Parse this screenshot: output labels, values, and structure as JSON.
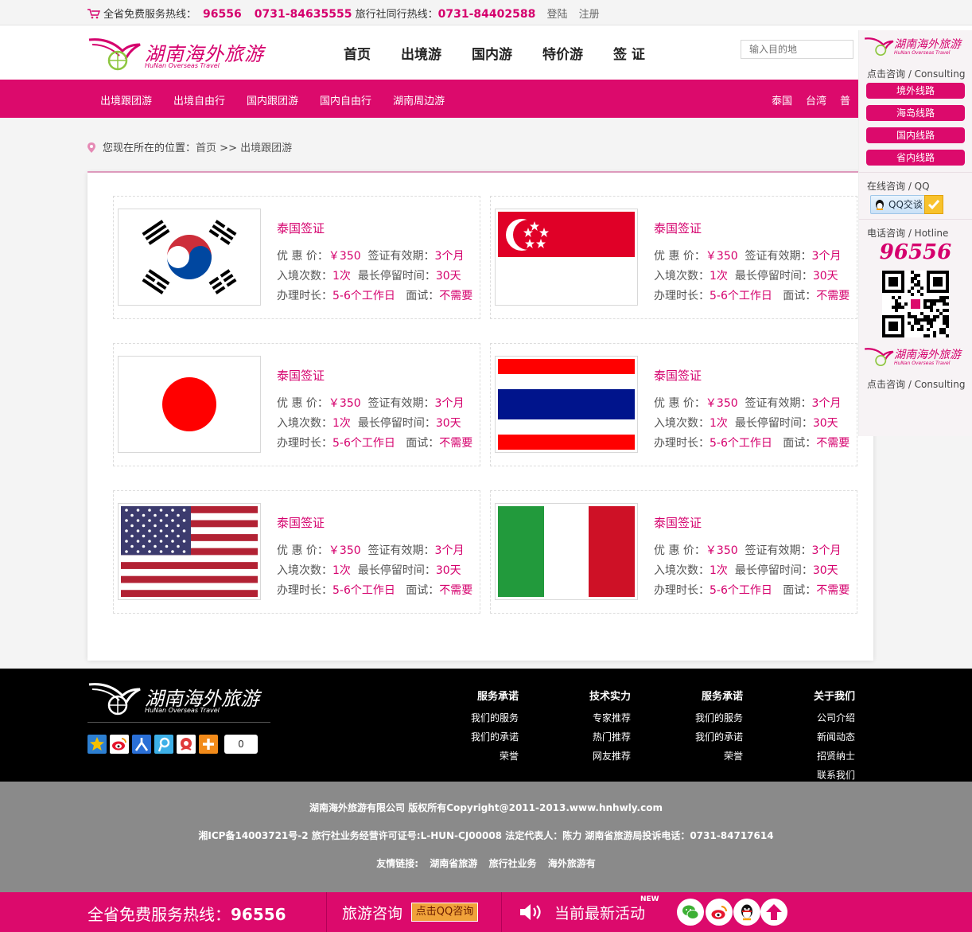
{
  "topbar": {
    "hotline_label": "全省免费服务热线：",
    "hotline_number": "96556",
    "hotline_phone": "0731-84635555",
    "peer_label": "旅行社同行热线：",
    "peer_phone": "0731-84402588",
    "login": "登陆",
    "register": "注册"
  },
  "logo": {
    "cn": "湖南海外旅游",
    "en": "HuNan  Overseas Travel"
  },
  "main_nav": [
    "首页",
    "出境游",
    "国内游",
    "特价游",
    "签 证"
  ],
  "search": {
    "placeholder": "输入目的地"
  },
  "sub_nav": {
    "left": [
      "出境跟团游",
      "出境自由行",
      "国内跟团游",
      "国内自由行",
      "湖南周边游"
    ],
    "right": [
      "泰国",
      "台湾",
      "普"
    ]
  },
  "breadcrumb": {
    "label": "您现在所在的位置：",
    "home": "首页",
    "sep": ">>",
    "current": "出境跟团游"
  },
  "visa_cards": [
    {
      "flag": "korea-flag",
      "title": "泰国签证",
      "price_label": "优 惠 价：",
      "price": "￥350",
      "valid_label": "签证有效期：",
      "valid": "3个月",
      "entries_label": "入境次数：",
      "entries": "1次",
      "stay_label": "最长停留时间：",
      "stay": "30天",
      "process_label": "办理时长：",
      "process": "5-6个工作日",
      "interview_label": "面试：",
      "interview": "不需要"
    },
    {
      "flag": "singapore-flag",
      "title": "泰国签证",
      "price_label": "优 惠 价：",
      "price": "￥350",
      "valid_label": "签证有效期：",
      "valid": "3个月",
      "entries_label": "入境次数：",
      "entries": "1次",
      "stay_label": "最长停留时间：",
      "stay": "30天",
      "process_label": "办理时长：",
      "process": "5-6个工作日",
      "interview_label": "面试：",
      "interview": "不需要"
    },
    {
      "flag": "japan-flag",
      "title": "泰国签证",
      "price_label": "优 惠 价：",
      "price": "￥350",
      "valid_label": "签证有效期：",
      "valid": "3个月",
      "entries_label": "入境次数：",
      "entries": "1次",
      "stay_label": "最长停留时间：",
      "stay": "30天",
      "process_label": "办理时长：",
      "process": "5-6个工作日",
      "interview_label": "面试：",
      "interview": "不需要"
    },
    {
      "flag": "thailand-flag",
      "title": "泰国签证",
      "price_label": "优 惠 价：",
      "price": "￥350",
      "valid_label": "签证有效期：",
      "valid": "3个月",
      "entries_label": "入境次数：",
      "entries": "1次",
      "stay_label": "最长停留时间：",
      "stay": "30天",
      "process_label": "办理时长：",
      "process": "5-6个工作日",
      "interview_label": "面试：",
      "interview": "不需要"
    },
    {
      "flag": "usa-flag",
      "title": "泰国签证",
      "price_label": "优 惠 价：",
      "price": "￥350",
      "valid_label": "签证有效期：",
      "valid": "3个月",
      "entries_label": "入境次数：",
      "entries": "1次",
      "stay_label": "最长停留时间：",
      "stay": "30天",
      "process_label": "办理时长：",
      "process": "5-6个工作日",
      "interview_label": "面试：",
      "interview": "不需要"
    },
    {
      "flag": "italy-flag",
      "title": "泰国签证",
      "price_label": "优 惠 价：",
      "price": "￥350",
      "valid_label": "签证有效期：",
      "valid": "3个月",
      "entries_label": "入境次数：",
      "entries": "1次",
      "stay_label": "最长停留时间：",
      "stay": "30天",
      "process_label": "办理时长：",
      "process": "5-6个工作日",
      "interview_label": "面试：",
      "interview": "不需要"
    }
  ],
  "sidebar": {
    "logo_cn": "湖南海外旅游",
    "logo_en": "HuNan Overseas Travel",
    "consult_label": "点击咨询 / Consulting",
    "routes": [
      "境外线路",
      "海岛线路",
      "国内线路",
      "省内线路"
    ],
    "qq_label": "在线咨询 / QQ",
    "qq_button": "QQ交谈",
    "hotline_label": "电话咨询 / Hotline",
    "hotline": "96556",
    "consult_label_2": "点击咨询 / Consulting"
  },
  "footer": {
    "logo_cn": "湖南海外旅游",
    "logo_en": "HuNan  Overseas Travel",
    "share_count": "0",
    "columns": [
      {
        "heading": "服务承诺",
        "items": [
          "我们的服务",
          "我们的承诺",
          "荣誉"
        ]
      },
      {
        "heading": "技术实力",
        "items": [
          "专家推荐",
          "热门推荐",
          "网友推荐"
        ]
      },
      {
        "heading": "服务承诺",
        "items": [
          "我们的服务",
          "我们的承诺",
          "荣誉"
        ]
      },
      {
        "heading": "关于我们",
        "items": [
          "公司介绍",
          "新闻动态",
          "招贤纳士",
          "联系我们"
        ]
      }
    ],
    "copyright": "湖南海外旅游有限公司 版权所有Copyright@2011-2013.www.hnhwly.com",
    "icp": "湘ICP备14003721号-2 旅行社业务经营许可证号:L-HUN-CJ00008 法定代表人：陈力 湖南省旅游局投诉电话：0731-84717614",
    "links_label": "友情链接:",
    "links": [
      "湖南省旅游",
      "旅行社业务",
      "海外旅游有"
    ]
  },
  "bottombar": {
    "hotline_label": "全省免费服务热线：",
    "hotline_number": "96556",
    "consult_label": "旅游咨询",
    "qq_button": "点击QQ咨询",
    "activity_label": "当前最新活动",
    "new_badge": "NEW"
  },
  "colors": {
    "brand_pink": "#dc0a6c",
    "text_pink": "#d5006d"
  }
}
